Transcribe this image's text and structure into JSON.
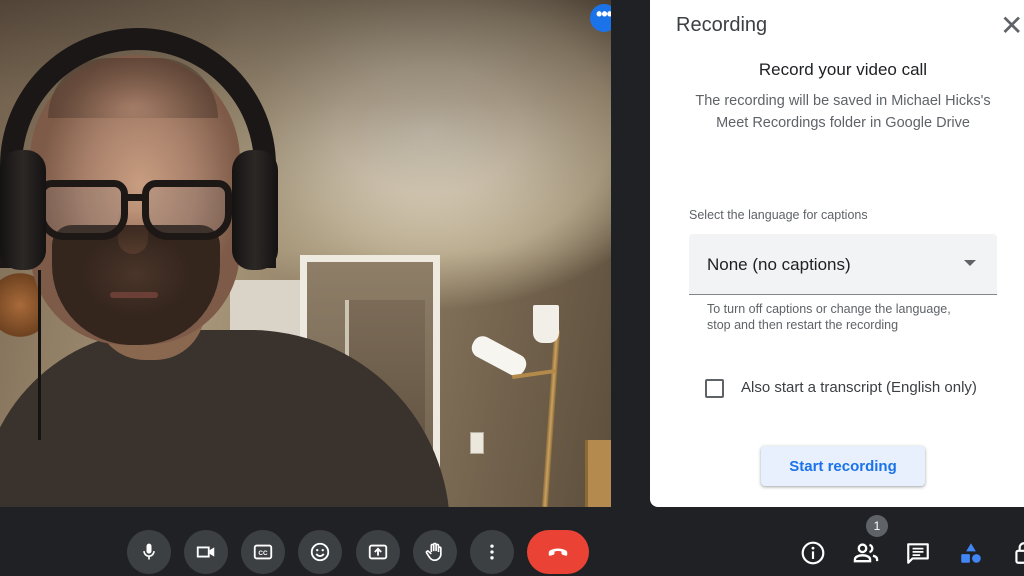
{
  "video": {
    "more_options_label": "•••"
  },
  "panel": {
    "title": "Recording",
    "close_glyph": "✕",
    "heading": "Record your video call",
    "description": "The recording will be saved in Michael Hicks's Meet Recordings folder in Google Drive",
    "language_label": "Select the language for captions",
    "language_value": "None (no captions)",
    "hint": "To turn off captions or change the language, stop and then restart the recording",
    "transcript_label": "Also start a transcript (English only)",
    "transcript_checked": false,
    "start_button": "Start recording"
  },
  "toolbar": {
    "controls": [
      "microphone-icon",
      "camera-icon",
      "captions-icon",
      "emoji-icon",
      "present-icon",
      "raise-hand-icon",
      "more-options-icon",
      "end-call-icon"
    ],
    "captions_text": "CC",
    "participants_count": "1",
    "right_icons": [
      "info-icon",
      "people-icon",
      "chat-icon",
      "activities-icon",
      "lock-icon"
    ]
  },
  "colors": {
    "accent": "#1a73e8",
    "end_call": "#ea4335",
    "bar_bg": "#202124",
    "button_bg": "#3c4043"
  }
}
